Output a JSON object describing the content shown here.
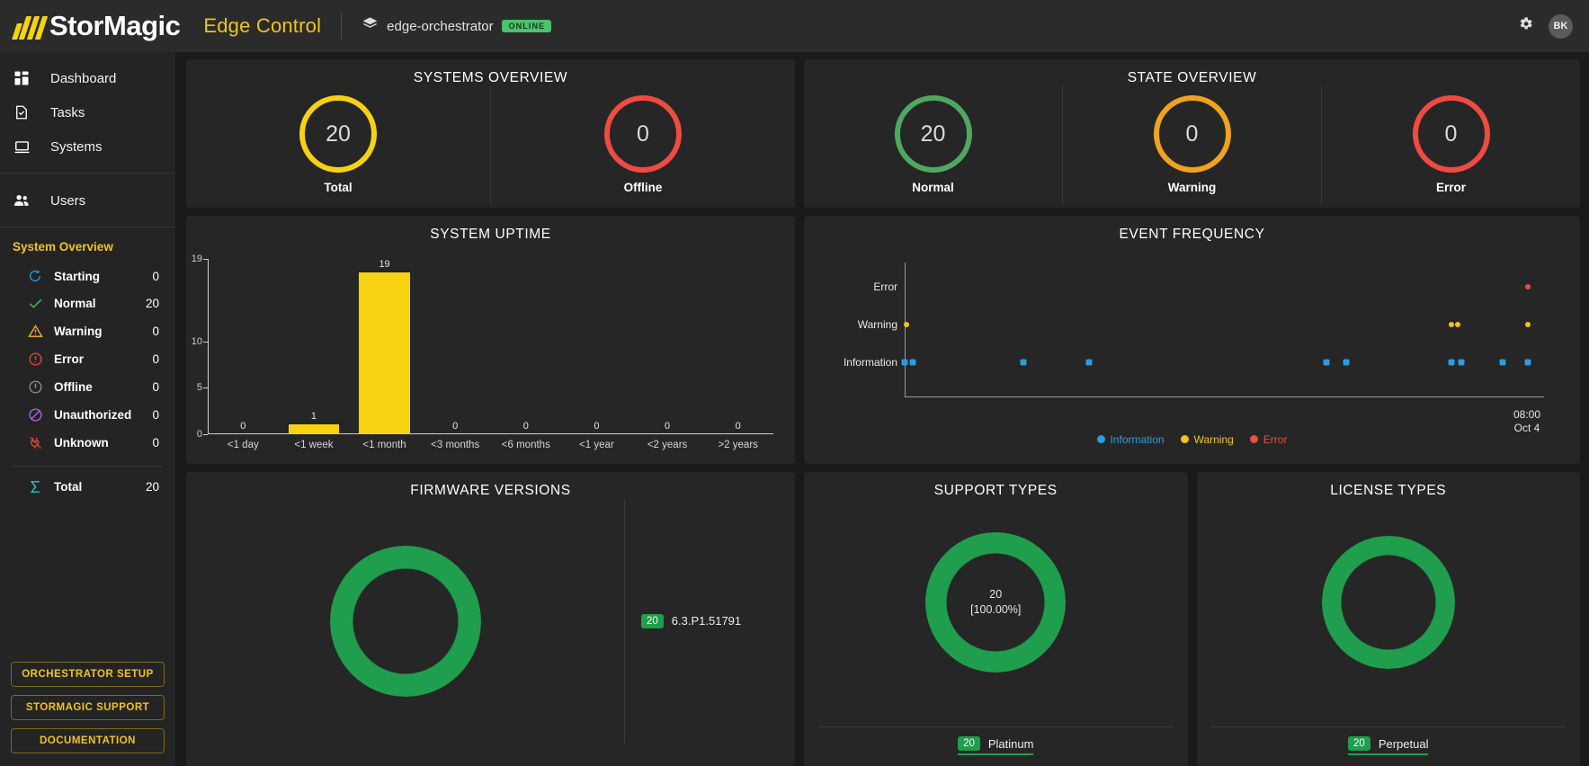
{
  "topbar": {
    "brand": "StorMagic",
    "product": "Edge Control",
    "orchestrator": "edge-orchestrator",
    "status_badge": "ONLINE",
    "avatar_initials": "BK"
  },
  "sidebar": {
    "nav": [
      {
        "label": "Dashboard",
        "icon": "dashboard-icon"
      },
      {
        "label": "Tasks",
        "icon": "tasks-icon"
      },
      {
        "label": "Systems",
        "icon": "systems-icon"
      },
      {
        "label": "Users",
        "icon": "users-icon"
      }
    ],
    "system_overview_title": "System Overview",
    "statuses": [
      {
        "label": "Starting",
        "count": "0",
        "color": "#2196d6"
      },
      {
        "label": "Normal",
        "count": "20",
        "color": "#3faf55"
      },
      {
        "label": "Warning",
        "count": "0",
        "color": "#f0b32b"
      },
      {
        "label": "Error",
        "count": "0",
        "color": "#e1473c"
      },
      {
        "label": "Offline",
        "count": "0",
        "color": "#8d8d8d"
      },
      {
        "label": "Unauthorized",
        "count": "0",
        "color": "#b661e8"
      },
      {
        "label": "Unknown",
        "count": "0",
        "color": "#e1473c"
      }
    ],
    "total": {
      "label": "Total",
      "count": "20",
      "color": "#28c8c8"
    },
    "buttons": [
      "ORCHESTRATOR SETUP",
      "STORMAGIC SUPPORT",
      "DOCUMENTATION"
    ]
  },
  "systems_overview": {
    "title": "SYSTEMS OVERVIEW",
    "counters": [
      {
        "value": "20",
        "label": "Total",
        "color": "#f5d312"
      },
      {
        "value": "0",
        "label": "Offline",
        "color": "#ee4b42"
      }
    ]
  },
  "state_overview": {
    "title": "STATE OVERVIEW",
    "counters": [
      {
        "value": "20",
        "label": "Normal",
        "color": "#4fa85f"
      },
      {
        "value": "0",
        "label": "Warning",
        "color": "#f0a31e"
      },
      {
        "value": "0",
        "label": "Error",
        "color": "#ee4b42"
      }
    ]
  },
  "chart_data": [
    {
      "type": "bar",
      "title": "SYSTEM UPTIME",
      "categories": [
        "<1 day",
        "<1 week",
        "<1 month",
        "<3 months",
        "<6 months",
        "<1 year",
        "<2 years",
        ">2 years"
      ],
      "values": [
        0,
        1,
        19,
        0,
        0,
        0,
        0,
        0
      ],
      "value_labels": [
        "0",
        "1",
        "19",
        "0",
        "0",
        "0",
        "0",
        "0"
      ],
      "yticks": [
        "19",
        "10",
        "5",
        "0"
      ],
      "ytick_values": [
        19,
        10,
        5,
        0
      ],
      "ylim": [
        0,
        19
      ],
      "xlabel": "",
      "ylabel": "",
      "grid": false,
      "bar_color": "#f5d312"
    },
    {
      "type": "scatter",
      "title": "EVENT FREQUENCY",
      "ycategories": [
        "Error",
        "Warning",
        "Information"
      ],
      "axis_end_label": {
        "time": "08:00",
        "date": "Oct 4"
      },
      "legend_position": "bottom",
      "legend": [
        {
          "name": "Information",
          "color": "#2e9bde"
        },
        {
          "name": "Warning",
          "color": "#f0c419"
        },
        {
          "name": "Error",
          "color": "#ee4b42"
        }
      ],
      "points": [
        {
          "series": "Information",
          "x": 0.0,
          "row": "Information"
        },
        {
          "series": "Information",
          "x": 1.2,
          "row": "Information"
        },
        {
          "series": "Information",
          "x": 18.5,
          "row": "Information"
        },
        {
          "series": "Information",
          "x": 28.8,
          "row": "Information"
        },
        {
          "series": "Information",
          "x": 66.0,
          "row": "Information"
        },
        {
          "series": "Information",
          "x": 69.0,
          "row": "Information"
        },
        {
          "series": "Information",
          "x": 85.5,
          "row": "Information"
        },
        {
          "series": "Information",
          "x": 87.0,
          "row": "Information"
        },
        {
          "series": "Information",
          "x": 93.5,
          "row": "Information"
        },
        {
          "series": "Information",
          "x": 97.5,
          "row": "Information"
        },
        {
          "series": "Warning",
          "x": 0.3,
          "row": "Warning"
        },
        {
          "series": "Warning",
          "x": 85.5,
          "row": "Warning"
        },
        {
          "series": "Warning",
          "x": 86.5,
          "row": "Warning"
        },
        {
          "series": "Warning",
          "x": 97.5,
          "row": "Warning"
        },
        {
          "series": "Error",
          "x": 97.5,
          "row": "Error"
        }
      ]
    },
    {
      "type": "pie",
      "title": "FIRMWARE VERSIONS",
      "labels": [
        "6.3.P1.51791"
      ],
      "values": [
        20
      ],
      "colors": [
        "#1f9e4d"
      ],
      "legend_position": "right"
    },
    {
      "type": "pie",
      "title": "SUPPORT TYPES",
      "labels": [
        "Platinum"
      ],
      "values": [
        20
      ],
      "colors": [
        "#1f9e4d"
      ],
      "center_value": "20",
      "center_percent": "[100.00%]",
      "legend_position": "bottom"
    },
    {
      "type": "pie",
      "title": "LICENSE TYPES",
      "labels": [
        "Perpetual"
      ],
      "values": [
        20
      ],
      "colors": [
        "#1f9e4d"
      ],
      "legend_position": "bottom"
    }
  ]
}
